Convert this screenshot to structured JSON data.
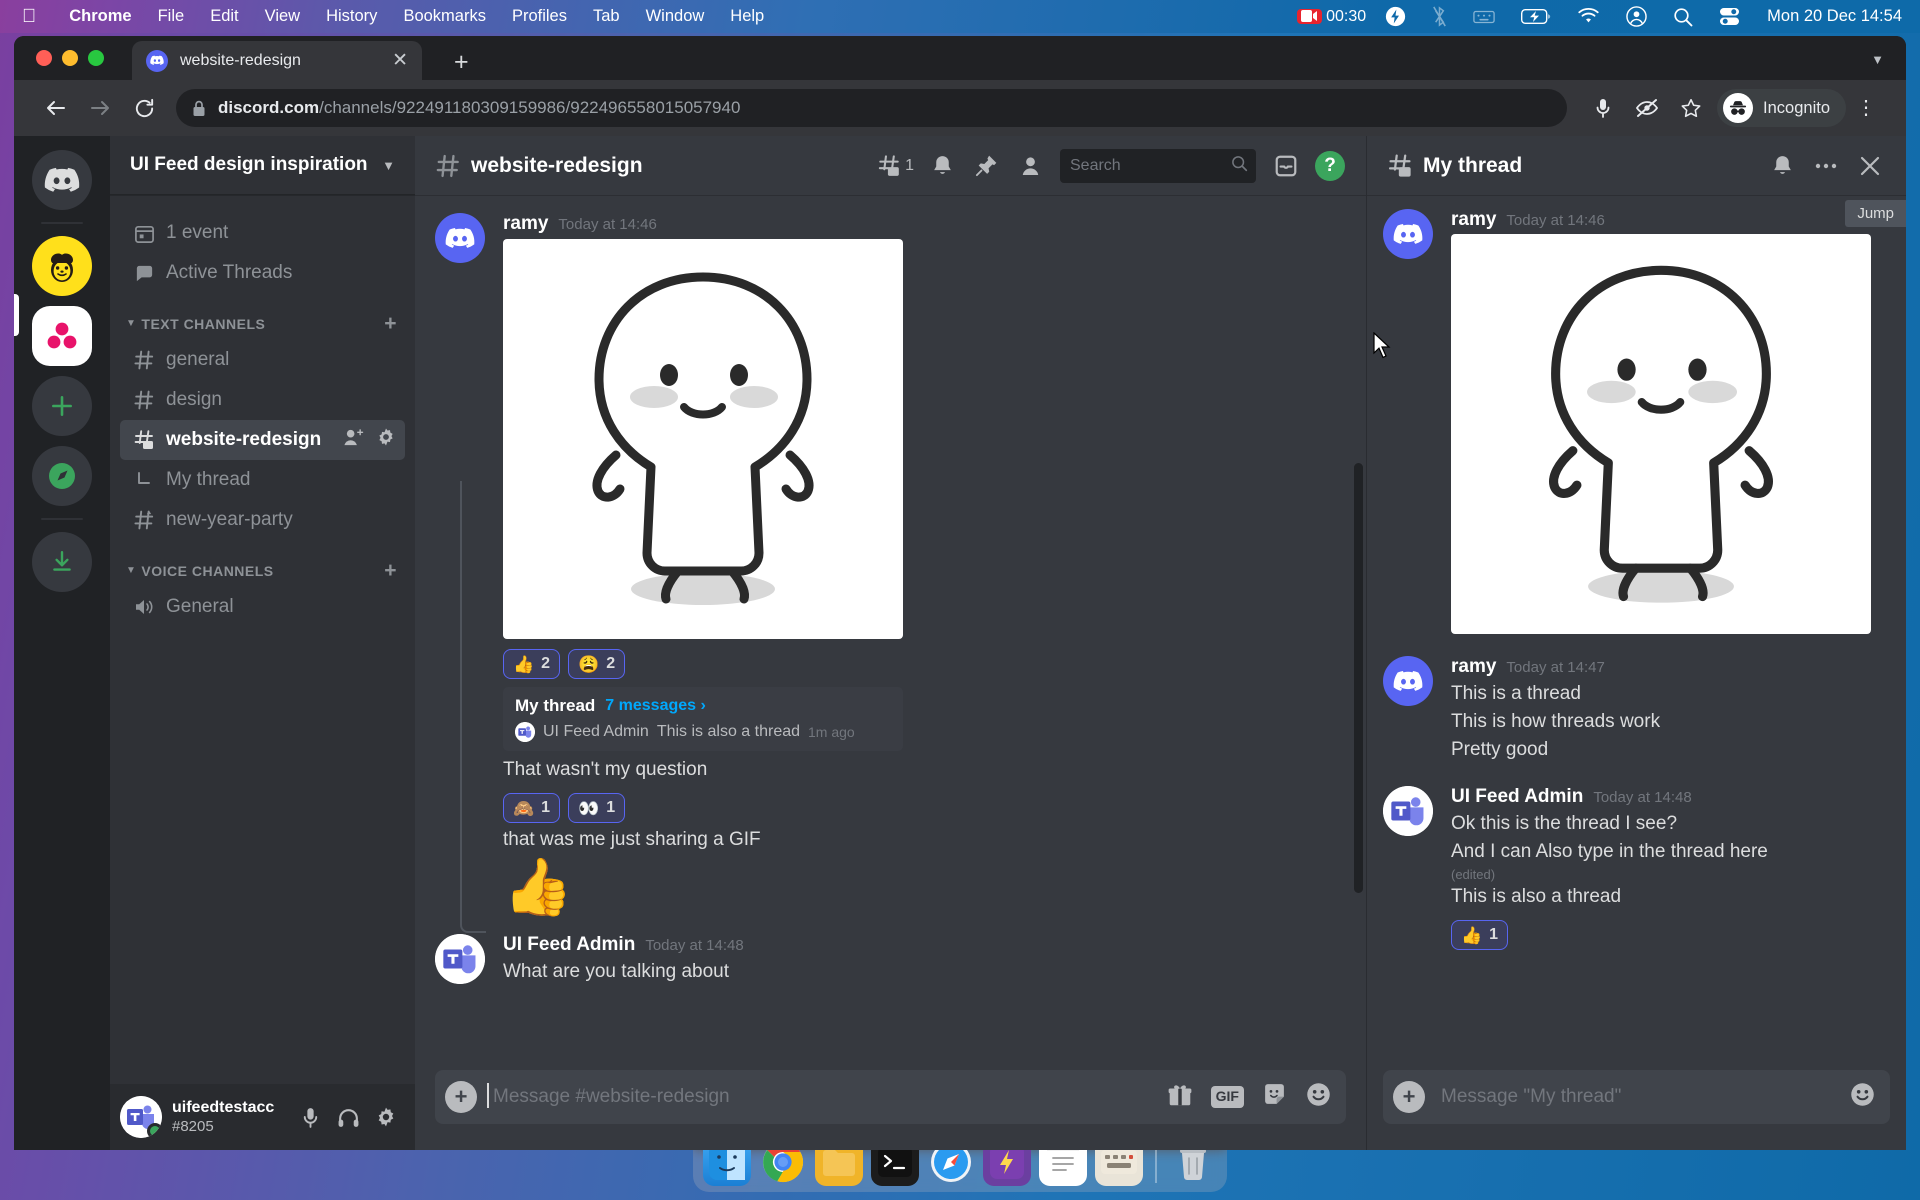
{
  "menubar": {
    "apple": "apple-logo",
    "items": [
      "Chrome",
      "File",
      "Edit",
      "View",
      "History",
      "Bookmarks",
      "Profiles",
      "Tab",
      "Window",
      "Help"
    ],
    "recording_time": "00:30",
    "datetime": "Mon 20 Dec  14:54",
    "right_icons": [
      "record-indicator",
      "bolt-icon",
      "bluetooth-off-icon",
      "keyboard-icon",
      "battery-charging-icon",
      "wifi-icon",
      "user-account-icon",
      "spotlight-search-icon",
      "control-center-icon"
    ]
  },
  "browser": {
    "tab_title": "website-redesign",
    "url_domain": "discord.com",
    "url_path": "/channels/922491180309159986/922496558015057940",
    "profile_label": "Incognito",
    "toolbar_icons": [
      "back-arrow-icon",
      "forward-arrow-icon",
      "reload-icon",
      "lock-icon",
      "microphone-icon",
      "eye-slash-icon",
      "star-icon",
      "kebab-menu-icon"
    ]
  },
  "rail": {
    "servers": [
      {
        "name": "direct-messages-home",
        "icon": "discord-logo",
        "active": false
      },
      {
        "name": "mailchimp-server",
        "icon": "mailchimp-monkey",
        "active": false
      },
      {
        "name": "ui-feed-server",
        "icon": "three-dots-logo",
        "active": true
      }
    ],
    "actions": [
      {
        "name": "add-server",
        "icon": "plus-icon"
      },
      {
        "name": "explore-servers",
        "icon": "compass-icon"
      },
      {
        "name": "download-apps",
        "icon": "download-icon"
      }
    ]
  },
  "sidebar": {
    "server_name": "UI Feed design inspiration",
    "quick": [
      {
        "label": "1 event",
        "icon": "calendar-icon"
      },
      {
        "label": "Active Threads",
        "icon": "threads-icon"
      }
    ],
    "categories": [
      {
        "label": "TEXT CHANNELS",
        "channels": [
          {
            "label": "general",
            "icon": "hash-icon",
            "active": false,
            "type": "text"
          },
          {
            "label": "design",
            "icon": "hash-icon",
            "active": false,
            "type": "text"
          },
          {
            "label": "website-redesign",
            "icon": "hash-thread-icon",
            "active": true,
            "type": "text"
          },
          {
            "label": "My thread",
            "icon": "thread-branch-icon",
            "active": false,
            "type": "thread"
          },
          {
            "label": "new-year-party",
            "icon": "hash-event-icon",
            "active": false,
            "type": "text"
          }
        ]
      },
      {
        "label": "VOICE CHANNELS",
        "channels": [
          {
            "label": "General",
            "icon": "speaker-icon",
            "active": false,
            "type": "voice"
          }
        ]
      }
    ],
    "user": {
      "name": "uifeedtestacc",
      "tag": "#8205",
      "status": "online",
      "controls": [
        "microphone-icon",
        "headphones-icon",
        "user-settings-gear-icon"
      ]
    }
  },
  "channel_header": {
    "title": "website-redesign",
    "thread_count": "1",
    "search_placeholder": "Search",
    "icons": [
      "hash-icon",
      "threads-icon",
      "notification-bell-icon",
      "pinned-messages-icon",
      "member-list-icon",
      "search-icon",
      "inbox-icon",
      "help-icon"
    ]
  },
  "chat": {
    "messages": [
      {
        "author": "ramy",
        "timestamp": "Today at 14:46",
        "avatar": "discord-logo-avatar",
        "attachment": "gif-white-blob-character",
        "reactions": [
          {
            "emoji": "👍",
            "count": "2"
          },
          {
            "emoji": "😩",
            "count": "2"
          }
        ],
        "thread_preview": {
          "name": "My thread",
          "count": "7 messages",
          "chevron": "›",
          "author": "UI Feed Admin",
          "text": "This is also a thread",
          "ago": "1m ago"
        },
        "lines": [
          {
            "text": "That wasn't my question",
            "reactions": [
              {
                "emoji": "🙈",
                "count": "1"
              },
              {
                "emoji": "👀",
                "count": "1"
              }
            ]
          },
          {
            "text": "that was me just sharing a GIF",
            "big_emoji": "👍"
          }
        ]
      },
      {
        "author": "UI Feed Admin",
        "timestamp": "Today at 14:48",
        "avatar": "teams-logo-avatar",
        "text": "What are you talking about"
      }
    ],
    "composer": {
      "placeholder": "Message #website-redesign",
      "icons": [
        "add-attachment-icon",
        "gift-icon",
        "gif-icon",
        "sticker-icon",
        "emoji-icon"
      ],
      "gif_label": "GIF"
    }
  },
  "thread_panel": {
    "title": "My thread",
    "icons": [
      "hash-thread-icon",
      "notification-bell-icon",
      "more-options-icon",
      "close-icon"
    ],
    "jump_label": "Jump",
    "messages": [
      {
        "author": "ramy",
        "timestamp": "Today at 14:46",
        "avatar": "discord-logo-avatar",
        "attachment": "gif-white-blob-character"
      },
      {
        "author": "ramy",
        "timestamp": "Today at 14:47",
        "avatar": "discord-logo-avatar",
        "lines": [
          "This is a thread",
          "This is how threads work",
          "Pretty good"
        ]
      },
      {
        "author": "UI Feed Admin",
        "timestamp": "Today at 14:48",
        "avatar": "teams-logo-avatar",
        "lines": [
          "Ok this is the thread I see?",
          "And I can Also type in the thread here"
        ],
        "edited": "(edited)",
        "extra_line": "This is also a thread",
        "reactions": [
          {
            "emoji": "👍",
            "count": "1"
          }
        ]
      }
    ],
    "composer": {
      "placeholder": "Message \"My thread\"",
      "icons": [
        "add-attachment-icon",
        "emoji-icon"
      ]
    }
  },
  "dock": {
    "items": [
      "finder-icon",
      "chrome-icon",
      "files-icon",
      "terminal-icon",
      "safari-icon",
      "lightning-icon",
      "notes-icon",
      "keyboard-icon",
      "trash-icon"
    ]
  },
  "colors": {
    "accent": "#5865f2",
    "link": "#00a8fc",
    "online": "#3ba55d",
    "record": "#e8242e"
  }
}
